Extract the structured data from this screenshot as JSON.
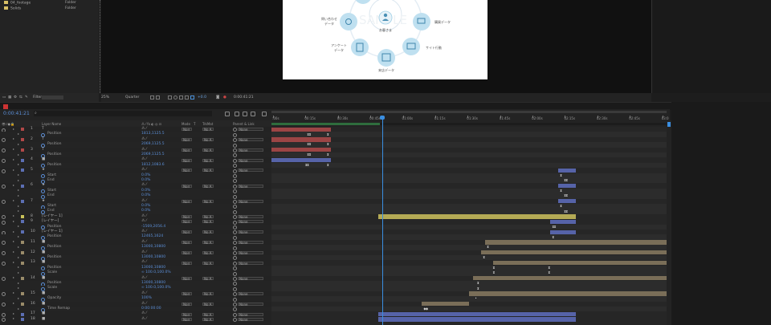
{
  "project": {
    "items": [
      {
        "name": "04_footage",
        "type": "Folder"
      },
      {
        "name": "Solids",
        "type": "Folder"
      }
    ],
    "footer_label": "Filter"
  },
  "viewer": {
    "zoom": "25%",
    "resolution": "Quarter",
    "exposure": "+0.0",
    "timecode": "0:00:41:21"
  },
  "comp_graphic": {
    "center_label": "お客さま",
    "watermark": "SAMPLE",
    "nodes": [
      "問い合わせ\nデータ",
      "購買データ",
      "アンケート\nデータ",
      "サイト行動",
      "来店データ"
    ]
  },
  "timeline": {
    "current_time": "0:00:41:21",
    "search_icon": "search-icon",
    "columns": {
      "layer_name": "Layer Name",
      "mode": "Mode",
      "trkmat": "TrkMat",
      "parent": "Parent & Link",
      "t": "T"
    },
    "ruler_labels": [
      ":00s",
      "00:15s",
      "00:30s",
      "00:45s",
      "01:00s",
      "01:15s",
      "01:30s",
      "01:45s",
      "02:00s",
      "02:15s",
      "02:30s",
      "02:45s",
      "03:0"
    ],
    "current_time_fraction": 0.28,
    "rows": [
      {
        "kind": "layer",
        "num": "1",
        "name": "T",
        "color": "#b04848",
        "switch": "⁂ ⁄",
        "val": ""
      },
      {
        "kind": "prop",
        "name": "Position",
        "val": "1813,1125.5"
      },
      {
        "kind": "layer",
        "num": "2",
        "name": "T",
        "color": "#b04848",
        "switch": "⁂ ⁄",
        "val": ""
      },
      {
        "kind": "prop",
        "name": "Position",
        "val": "2069,1125.5"
      },
      {
        "kind": "layer",
        "num": "3",
        "name": "T",
        "color": "#b04848",
        "switch": "⁂ ⁄",
        "val": ""
      },
      {
        "kind": "prop",
        "name": "Position",
        "val": "2069,1125.5"
      },
      {
        "kind": "layer",
        "num": "4",
        "name": "■",
        "color": "#5c6fb3",
        "switch": "⁂ ⁄",
        "val": ""
      },
      {
        "kind": "prop",
        "name": "Position",
        "val": "1812,1083.6"
      },
      {
        "kind": "layer",
        "num": "5",
        "name": "★",
        "color": "#5c6fb3",
        "switch": "⁂ ⁄",
        "val": ""
      },
      {
        "kind": "prop",
        "name": "Start",
        "val": "0.0%"
      },
      {
        "kind": "prop",
        "name": "End",
        "val": "0.0%"
      },
      {
        "kind": "layer",
        "num": "6",
        "name": "★",
        "color": "#5c6fb3",
        "switch": "⁂ ⁄",
        "val": ""
      },
      {
        "kind": "prop",
        "name": "Start",
        "val": "0.0%"
      },
      {
        "kind": "prop",
        "name": "End",
        "val": "0.0%"
      },
      {
        "kind": "layer",
        "num": "7",
        "name": "★",
        "color": "#5c6fb3",
        "switch": "⁂ ⁄",
        "val": ""
      },
      {
        "kind": "prop",
        "name": "Start",
        "val": "0.0%"
      },
      {
        "kind": "prop",
        "name": "End",
        "val": "0.0%"
      },
      {
        "kind": "layer",
        "num": "8",
        "name": "[レイヤー 1]",
        "color": "#c9c25a",
        "switch": "⁂ ⁄",
        "val": ""
      },
      {
        "kind": "layer",
        "num": "9",
        "name": "[レイヤー]",
        "color": "#5c6fb3",
        "switch": "⁂ ⁄",
        "val": ""
      },
      {
        "kind": "prop",
        "name": "Position",
        "val": "-1569,2056.4"
      },
      {
        "kind": "layer",
        "num": "10",
        "name": "[レイヤー 1]",
        "color": "#5c6fb3",
        "switch": "⁂ ⁄",
        "val": ""
      },
      {
        "kind": "prop",
        "name": "Position",
        "val": "12465,1624"
      },
      {
        "kind": "layer",
        "num": "11",
        "name": "■",
        "color": "#9a8c6a",
        "switch": "⁂ ⁄",
        "val": ""
      },
      {
        "kind": "prop",
        "name": "Position",
        "val": "13000,10800"
      },
      {
        "kind": "layer",
        "num": "12",
        "name": "■",
        "color": "#9a8c6a",
        "switch": "⁂ ⁄",
        "val": ""
      },
      {
        "kind": "prop",
        "name": "Position",
        "val": "13000,10800"
      },
      {
        "kind": "layer",
        "num": "13",
        "name": "■",
        "color": "#9a8c6a",
        "switch": "⁂ ⁄",
        "val": ""
      },
      {
        "kind": "prop",
        "name": "Position",
        "val": "13000,10800"
      },
      {
        "kind": "prop",
        "name": "Scale",
        "val": "∞ 100.0,100.0%"
      },
      {
        "kind": "layer",
        "num": "14",
        "name": "■",
        "color": "#9a8c6a",
        "switch": "⁂ ⁄",
        "val": ""
      },
      {
        "kind": "prop",
        "name": "Position",
        "val": "13000,10800"
      },
      {
        "kind": "prop",
        "name": "Scale",
        "val": "∞ 100.0,100.0%"
      },
      {
        "kind": "layer",
        "num": "15",
        "name": "■",
        "color": "#9a8c6a",
        "switch": "⁂ ⁄",
        "val": ""
      },
      {
        "kind": "prop",
        "name": "Opacity",
        "val": "100%"
      },
      {
        "kind": "layer",
        "num": "16",
        "name": "■",
        "color": "#9a8c6a",
        "switch": "⁂ ⁄",
        "val": ""
      },
      {
        "kind": "prop",
        "name": "Time Remap",
        "val": "0:00:00:00"
      },
      {
        "kind": "layer",
        "num": "17",
        "name": "■",
        "color": "#5c6fb3",
        "switch": "⁂ ⁄",
        "val": ""
      },
      {
        "kind": "layer",
        "num": "18",
        "name": "■",
        "color": "#5c6fb3",
        "switch": "⁂ ⁄",
        "val": ""
      }
    ],
    "mode_value": "Norr",
    "trkmat_value": "No A",
    "parent_value": "None",
    "tracks": [
      {
        "bars": [
          {
            "s": 0.0,
            "e": 0.15,
            "c": "#9c4545"
          }
        ]
      },
      {
        "keys": [
          {
            "p": 0.09,
            "t": "⧗⧗"
          },
          {
            "p": 0.14,
            "t": "⧗"
          }
        ]
      },
      {
        "bars": [
          {
            "s": 0.0,
            "e": 0.15,
            "c": "#9c4545"
          }
        ]
      },
      {
        "keys": [
          {
            "p": 0.09,
            "t": "⧗⧗"
          },
          {
            "p": 0.14,
            "t": "⧗"
          }
        ]
      },
      {
        "bars": [
          {
            "s": 0.0,
            "e": 0.15,
            "c": "#9c4545"
          }
        ]
      },
      {
        "keys": [
          {
            "p": 0.09,
            "t": "⧗⧗"
          },
          {
            "p": 0.14,
            "t": "⧗"
          }
        ]
      },
      {
        "bars": [
          {
            "s": 0.0,
            "e": 0.15,
            "c": "#5663a8"
          }
        ]
      },
      {
        "keys": [
          {
            "p": 0.085,
            "t": "⧗⧗"
          },
          {
            "p": 0.14,
            "t": "⧗"
          }
        ]
      },
      {
        "bars": [
          {
            "s": 0.725,
            "e": 0.77,
            "c": "#5663a8"
          }
        ]
      },
      {
        "keys": [
          {
            "p": 0.73,
            "t": "⧗"
          }
        ]
      },
      {
        "keys": [
          {
            "p": 0.74,
            "t": "⧗⧗"
          }
        ]
      },
      {
        "bars": [
          {
            "s": 0.725,
            "e": 0.77,
            "c": "#5663a8"
          }
        ]
      },
      {
        "keys": [
          {
            "p": 0.73,
            "t": "⧗"
          }
        ]
      },
      {
        "keys": [
          {
            "p": 0.74,
            "t": "⧗⧗"
          }
        ]
      },
      {
        "bars": [
          {
            "s": 0.725,
            "e": 0.77,
            "c": "#5663a8"
          }
        ]
      },
      {
        "keys": [
          {
            "p": 0.73,
            "t": "⧗"
          }
        ]
      },
      {
        "keys": [
          {
            "p": 0.74,
            "t": "⧗⧗"
          }
        ]
      },
      {
        "bars": [
          {
            "s": 0.27,
            "e": 0.77,
            "c": "#b4aa55"
          }
        ]
      },
      {
        "bars": [
          {
            "s": 0.705,
            "e": 0.77,
            "c": "#5663a8"
          }
        ]
      },
      {
        "keys": [
          {
            "p": 0.71,
            "t": "⧗⧗"
          }
        ]
      },
      {
        "bars": [
          {
            "s": 0.705,
            "e": 0.77,
            "c": "#5663a8"
          }
        ]
      },
      {
        "keys": [
          {
            "p": 0.71,
            "t": "⧗"
          }
        ]
      },
      {
        "bars": [
          {
            "s": 0.54,
            "e": 1.0,
            "c": "#7a6e58"
          }
        ]
      },
      {
        "keys": [
          {
            "p": 0.545,
            "t": "⧗"
          }
        ]
      },
      {
        "bars": [
          {
            "s": 0.53,
            "e": 1.0,
            "c": "#7a6e58"
          }
        ]
      },
      {
        "keys": [
          {
            "p": 0.535,
            "t": "⧗"
          }
        ]
      },
      {
        "bars": [
          {
            "s": 0.56,
            "e": 1.0,
            "c": "#7a6e58"
          }
        ]
      },
      {
        "keys": [
          {
            "p": 0.56,
            "t": "⧗"
          },
          {
            "p": 0.7,
            "t": "⧗"
          }
        ]
      },
      {
        "keys": [
          {
            "p": 0.56,
            "t": "⧗"
          },
          {
            "p": 0.7,
            "t": "⧗"
          }
        ]
      },
      {
        "bars": [
          {
            "s": 0.51,
            "e": 1.0,
            "c": "#7a6e58"
          }
        ]
      },
      {
        "keys": [
          {
            "p": 0.52,
            "t": "⧗"
          }
        ]
      },
      {
        "keys": [
          {
            "p": 0.52,
            "t": "⧗"
          }
        ]
      },
      {
        "bars": [
          {
            "s": 0.5,
            "e": 1.0,
            "c": "#7a6e58"
          }
        ]
      },
      {
        "keys": [
          {
            "p": 0.515,
            "t": "•"
          }
        ]
      },
      {
        "bars": [
          {
            "s": 0.38,
            "e": 0.5,
            "c": "#7a6e58"
          }
        ]
      },
      {
        "keys": [
          {
            "p": 0.385,
            "t": "◆◆"
          }
        ]
      },
      {
        "bars": [
          {
            "s": 0.27,
            "e": 0.77,
            "c": "#5663a8"
          }
        ]
      },
      {
        "bars": [
          {
            "s": 0.27,
            "e": 0.77,
            "c": "#5663a8"
          }
        ]
      }
    ]
  }
}
